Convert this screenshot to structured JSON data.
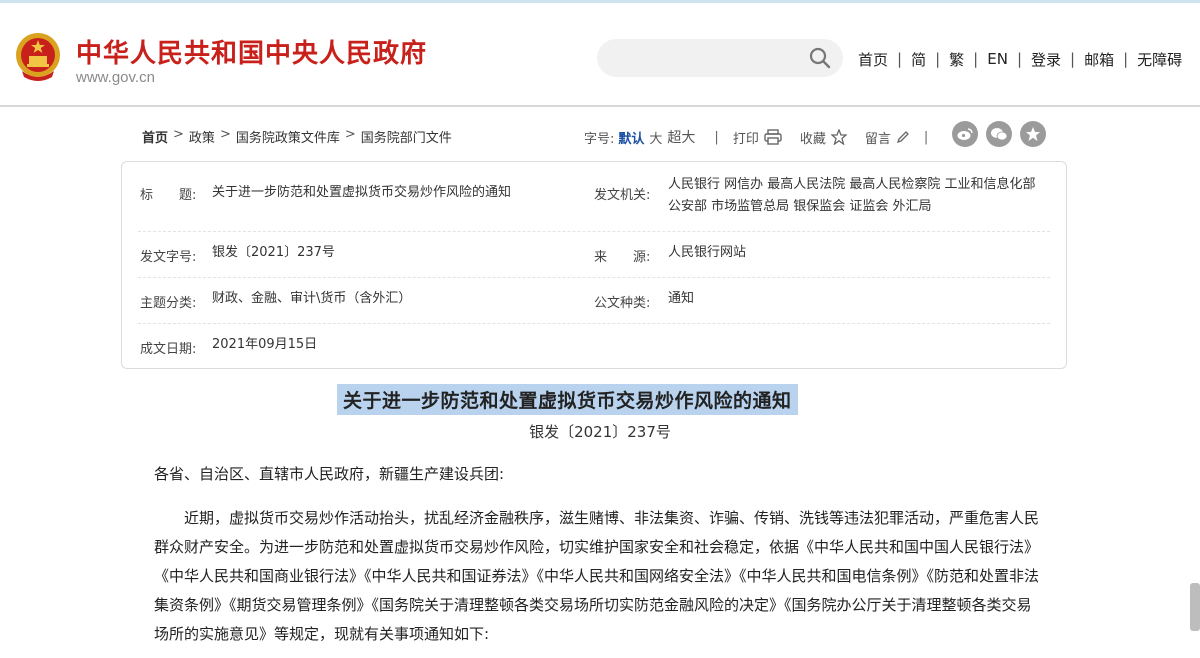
{
  "header": {
    "site_title": "中华人民共和国中央人民政府",
    "site_url": "www.gov.cn",
    "search": {
      "placeholder": ""
    },
    "nav": [
      "首页",
      "简",
      "繁",
      "EN",
      "登录",
      "邮箱",
      "无障碍"
    ],
    "nav_separator": "|"
  },
  "breadcrumb": [
    "首页",
    "政策",
    "国务院政策文件库",
    "国务院部门文件"
  ],
  "breadcrumb_separator": ">",
  "toolbar": {
    "font_label": "字号:",
    "sizes": [
      "默认",
      "大",
      "超大"
    ],
    "active_size": "默认",
    "print_label": "打印",
    "favorite_label": "收藏",
    "comment_label": "留言",
    "separator": "|"
  },
  "share": [
    "weibo-icon",
    "wechat-icon",
    "qzone-icon"
  ],
  "info_table": {
    "title_label": "标　　题:",
    "title_value": "关于进一步防范和处置虚拟货币交易炒作风险的通知",
    "issuer_label": "发文机关:",
    "issuer_line1": "人民银行 网信办 最高人民法院 最高人民检察院 工业和信息化部",
    "issuer_line2": "公安部 市场监管总局 银保监会 证监会 外汇局",
    "docnum_label": "发文字号:",
    "docnum_value": "银发〔2021〕237号",
    "source_label": "来　　源:",
    "source_value": "人民银行网站",
    "topic_label": "主题分类:",
    "topic_value": "财政、金融、审计\\货币（含外汇）",
    "type_label": "公文种类:",
    "type_value": "通知",
    "date_label": "成文日期:",
    "date_value": "2021年09月15日"
  },
  "document": {
    "title": "关于进一步防范和处置虚拟货币交易炒作风险的通知",
    "number": "银发〔2021〕237号",
    "salutation": "各省、自治区、直辖市人民政府，新疆生产建设兵团:",
    "paragraph1": "近期，虚拟货币交易炒作活动抬头，扰乱经济金融秩序，滋生赌博、非法集资、诈骗、传销、洗钱等违法犯罪活动，严重危害人民群众财产安全。为进一步防范和处置虚拟货币交易炒作风险，切实维护国家安全和社会稳定，依据《中华人民共和国中国人民银行法》《中华人民共和国商业银行法》《中华人民共和国证券法》《中华人民共和国网络安全法》《中华人民共和国电信条例》《防范和处置非法集资条例》《期货交易管理条例》《国务院关于清理整顿各类交易场所切实防范金融风险的决定》《国务院办公厅关于清理整顿各类交易场所的实施意见》等规定，现就有关事项通知如下:"
  },
  "colors": {
    "brand_red": "#c8201a",
    "selection_blue": "#b9d3ef",
    "active_size_blue": "#1a4fa3"
  }
}
